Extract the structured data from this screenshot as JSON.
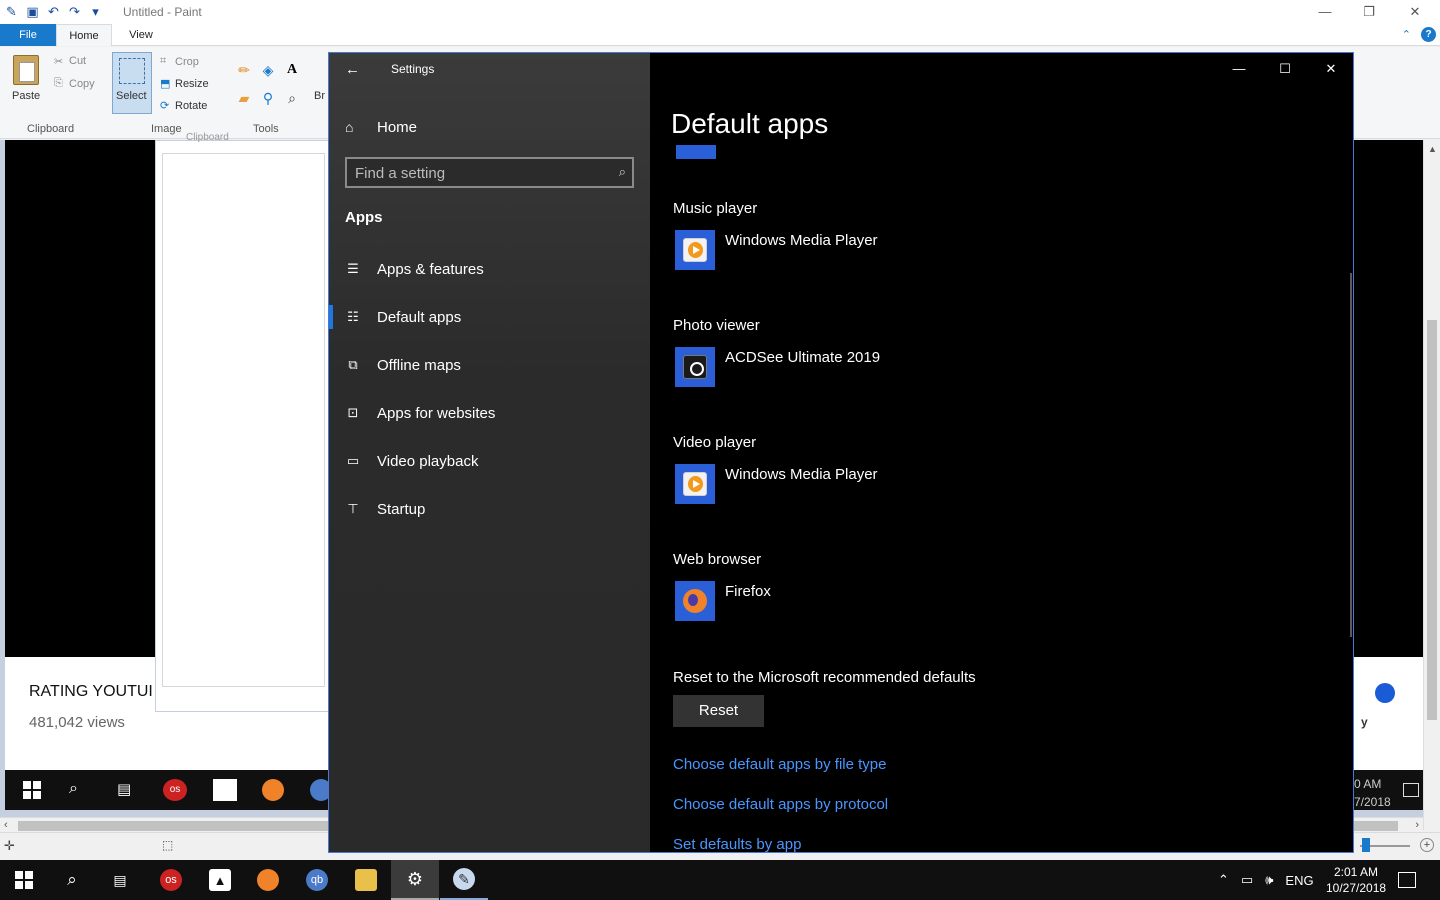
{
  "paint": {
    "title": "Untitled - Paint",
    "tabs": {
      "file": "File",
      "home": "Home",
      "view": "View"
    },
    "clipboard": {
      "paste": "Paste",
      "cut": "Cut",
      "copy": "Copy",
      "group": "Clipboard"
    },
    "image": {
      "select": "Select",
      "crop": "Crop",
      "resize": "Resize",
      "rotate": "Rotate",
      "group": "Image"
    },
    "tools": {
      "group": "Tools",
      "brush_partial": "Br"
    },
    "doc_labels": {
      "clipboard": "Clipboard"
    }
  },
  "video": {
    "title": "RATING YOUTUI",
    "views": "481,042 views",
    "inner_clock_time": "0 AM",
    "inner_clock_date": "7/2018",
    "side_char": "y"
  },
  "settings": {
    "window_title": "Settings",
    "home_label": "Home",
    "search_placeholder": "Find a setting",
    "section": "Apps",
    "nav": [
      {
        "label": "Apps & features",
        "icon": "list-icon"
      },
      {
        "label": "Default apps",
        "icon": "default-apps-icon"
      },
      {
        "label": "Offline maps",
        "icon": "map-icon"
      },
      {
        "label": "Apps for websites",
        "icon": "open-link-icon"
      },
      {
        "label": "Video playback",
        "icon": "video-icon"
      },
      {
        "label": "Startup",
        "icon": "startup-icon"
      }
    ],
    "active_nav": "Default apps",
    "heading": "Default apps",
    "defaults": [
      {
        "category": "Music player",
        "app": "Windows Media Player",
        "icon": "windows-media-player-icon"
      },
      {
        "category": "Photo viewer",
        "app": "ACDSee Ultimate 2019",
        "icon": "acdsee-icon"
      },
      {
        "category": "Video player",
        "app": "Windows Media Player",
        "icon": "windows-media-player-icon"
      },
      {
        "category": "Web browser",
        "app": "Firefox",
        "icon": "firefox-icon"
      }
    ],
    "reset_label": "Reset to the Microsoft recommended defaults",
    "reset_button": "Reset",
    "links": [
      "Choose default apps by file type",
      "Choose default apps by protocol",
      "Set defaults by app"
    ],
    "accent": "#1f78e0",
    "link_color": "#4a96ff"
  },
  "taskbar": {
    "items": [
      "start-icon",
      "search-icon",
      "task-view-icon",
      "lastpass-icon",
      "photos-icon",
      "firefox-icon",
      "qbittorrent-icon",
      "file-explorer-icon",
      "settings-icon",
      "paint-icon"
    ],
    "tray_lang": "ENG",
    "time": "2:01 AM",
    "date": "10/27/2018"
  }
}
